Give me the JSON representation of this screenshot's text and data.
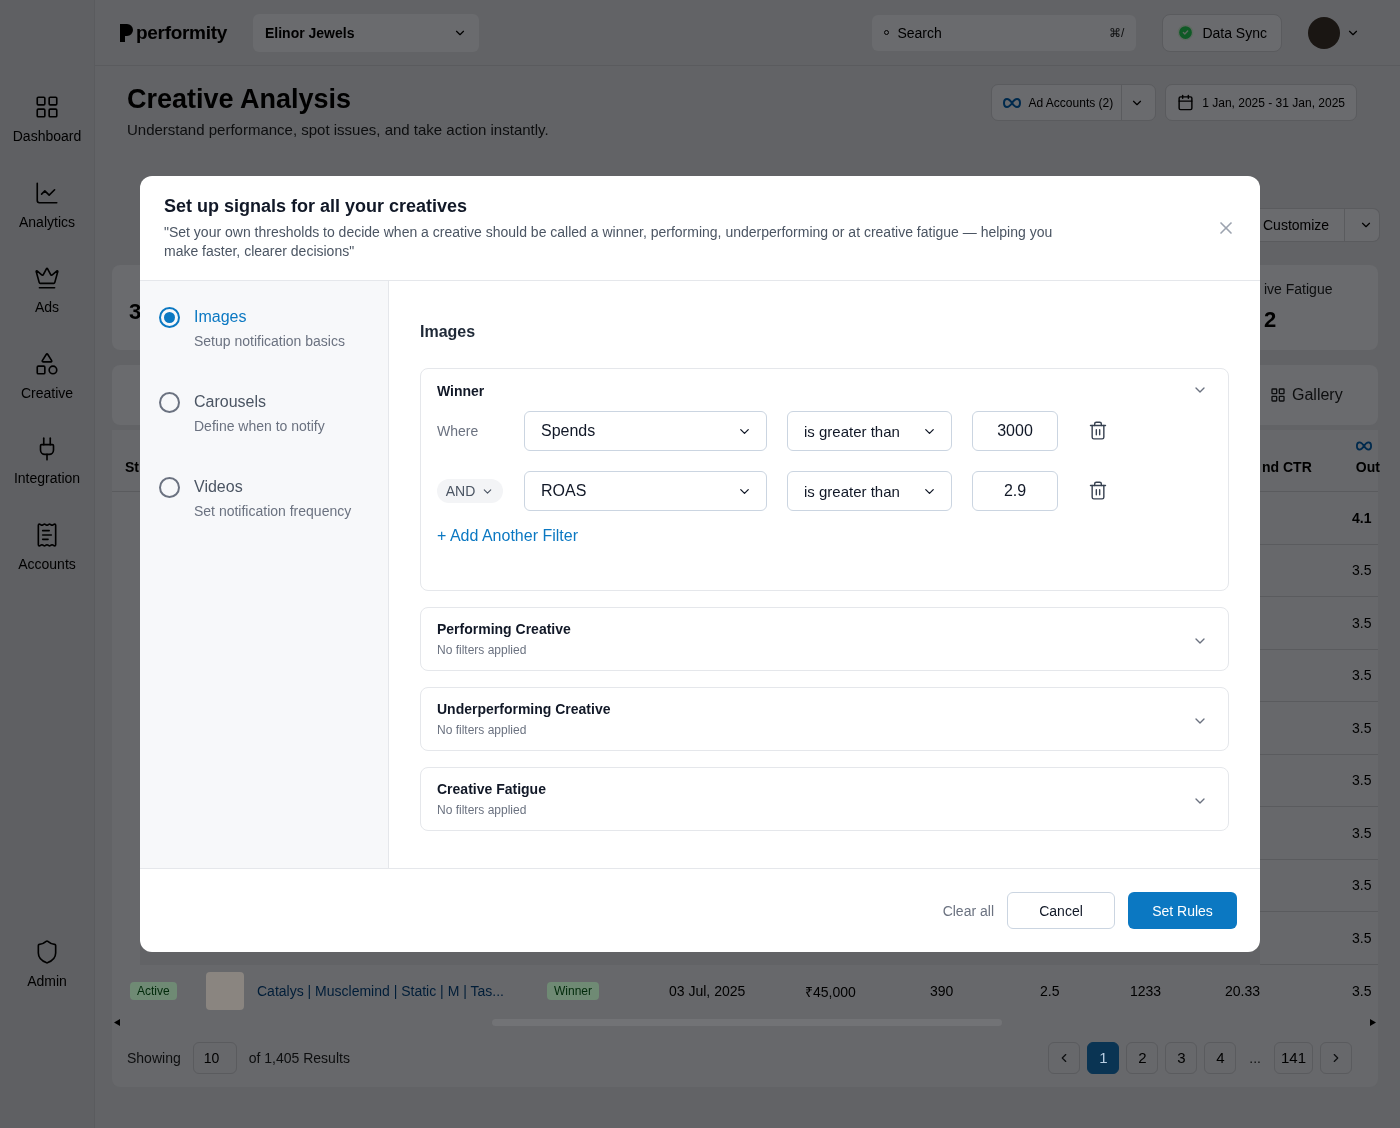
{
  "sidebar": {
    "items": [
      {
        "label": "Dashboard",
        "selected": false
      },
      {
        "label": "Analytics",
        "selected": false
      },
      {
        "label": "Ads",
        "selected": false
      },
      {
        "label": "Creative",
        "selected": false
      },
      {
        "label": "Integration",
        "selected": false
      },
      {
        "label": "Accounts",
        "selected": false
      }
    ],
    "footer_item": {
      "label": "Admin",
      "selected": false
    }
  },
  "topbar": {
    "brand": "performity",
    "account": "Elinor Jewels",
    "search": {
      "placeholder": "Search",
      "shortcut": "⌘/"
    },
    "sync": "Data Sync"
  },
  "header": {
    "title": "Creative Analysis",
    "subtitle": "Understand performance, spot issues, and take action instantly.",
    "ad_accounts": "Ad Accounts (2)",
    "date_range": "1 Jan, 2025 - 31 Jan, 2025"
  },
  "left_edge": {
    "stat_value": "3",
    "column_header": "St"
  },
  "right_edge": {
    "customize": "Customize",
    "stat_label": "ive Fatigue",
    "stat_value": "2",
    "gallery": "Gallery",
    "columns": [
      "nd CTR",
      "Out"
    ],
    "values": [
      "4.1",
      "3.5",
      "3.5",
      "3.5",
      "3.5",
      "3.5",
      "3.5",
      "3.5",
      "3.5"
    ]
  },
  "last_row": {
    "status": "Active",
    "name": "Catalys | Musclemind | Static | M | Tas...",
    "tag": "Winner",
    "date": "03 Jul, 2025",
    "spend": "₹45,000",
    "cells": [
      "390",
      "2.5",
      "1233",
      "20.33",
      "3.5"
    ]
  },
  "pagination": {
    "showing_label": "Showing",
    "page_size": "10",
    "results": "of 1,405 Results",
    "ellipsis": "...",
    "pages": [
      {
        "label": "1",
        "selected": true
      },
      {
        "label": "2",
        "selected": false
      },
      {
        "label": "3",
        "selected": false
      },
      {
        "label": "4",
        "selected": false
      },
      {
        "label": "141",
        "selected": false
      }
    ]
  },
  "modal": {
    "title": "Set up signals for all your creatives",
    "description": "\"Set your own thresholds to decide when a creative should be called a winner, performing, underperforming or at creative fatigue — helping you make faster, clearer decisions\"",
    "nav": [
      {
        "title": "Images",
        "subtitle": "Setup notification basics",
        "selected": true
      },
      {
        "title": "Carousels",
        "subtitle": "Define when to notify",
        "selected": false
      },
      {
        "title": "Videos",
        "subtitle": "Set notification frequency",
        "selected": false
      }
    ],
    "section_title": "Images",
    "groups": [
      {
        "title": "Winner",
        "expanded": true,
        "filters": [
          {
            "kind": "where",
            "label": "Where",
            "field": "Spends",
            "operator": "is greater than",
            "value": "3000"
          },
          {
            "kind": "connector",
            "label": "AND",
            "field": "ROAS",
            "operator": "is greater than",
            "value": "2.9"
          }
        ],
        "add_filter": "+ Add Another Filter"
      },
      {
        "title": "Performing Creative",
        "expanded": false,
        "summary": "No filters applied"
      },
      {
        "title": "Underperforming Creative",
        "expanded": false,
        "summary": "No filters applied"
      },
      {
        "title": "Creative Fatigue",
        "expanded": false,
        "summary": "No filters applied"
      }
    ],
    "footer": {
      "clear": "Clear all",
      "cancel": "Cancel",
      "submit": "Set Rules"
    }
  }
}
